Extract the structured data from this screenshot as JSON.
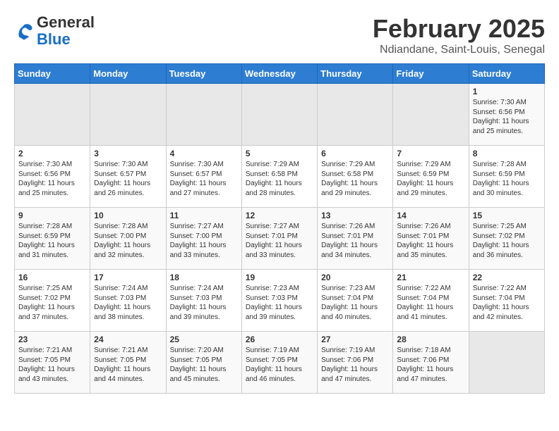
{
  "header": {
    "logo_general": "General",
    "logo_blue": "Blue",
    "title": "February 2025",
    "subtitle": "Ndiandane, Saint-Louis, Senegal"
  },
  "weekdays": [
    "Sunday",
    "Monday",
    "Tuesday",
    "Wednesday",
    "Thursday",
    "Friday",
    "Saturday"
  ],
  "weeks": [
    [
      {
        "day": "",
        "empty": true
      },
      {
        "day": "",
        "empty": true
      },
      {
        "day": "",
        "empty": true
      },
      {
        "day": "",
        "empty": true
      },
      {
        "day": "",
        "empty": true
      },
      {
        "day": "",
        "empty": true
      },
      {
        "day": "1",
        "sunrise": "7:30 AM",
        "sunset": "6:56 PM",
        "daylight": "11 hours and 25 minutes."
      }
    ],
    [
      {
        "day": "2",
        "sunrise": "7:30 AM",
        "sunset": "6:56 PM",
        "daylight": "11 hours and 25 minutes."
      },
      {
        "day": "3",
        "sunrise": "7:30 AM",
        "sunset": "6:57 PM",
        "daylight": "11 hours and 26 minutes."
      },
      {
        "day": "4",
        "sunrise": "7:30 AM",
        "sunset": "6:57 PM",
        "daylight": "11 hours and 27 minutes."
      },
      {
        "day": "5",
        "sunrise": "7:29 AM",
        "sunset": "6:58 PM",
        "daylight": "11 hours and 28 minutes."
      },
      {
        "day": "6",
        "sunrise": "7:29 AM",
        "sunset": "6:58 PM",
        "daylight": "11 hours and 29 minutes."
      },
      {
        "day": "7",
        "sunrise": "7:29 AM",
        "sunset": "6:59 PM",
        "daylight": "11 hours and 29 minutes."
      },
      {
        "day": "8",
        "sunrise": "7:28 AM",
        "sunset": "6:59 PM",
        "daylight": "11 hours and 30 minutes."
      }
    ],
    [
      {
        "day": "9",
        "sunrise": "7:28 AM",
        "sunset": "6:59 PM",
        "daylight": "11 hours and 31 minutes."
      },
      {
        "day": "10",
        "sunrise": "7:28 AM",
        "sunset": "7:00 PM",
        "daylight": "11 hours and 32 minutes."
      },
      {
        "day": "11",
        "sunrise": "7:27 AM",
        "sunset": "7:00 PM",
        "daylight": "11 hours and 33 minutes."
      },
      {
        "day": "12",
        "sunrise": "7:27 AM",
        "sunset": "7:01 PM",
        "daylight": "11 hours and 33 minutes."
      },
      {
        "day": "13",
        "sunrise": "7:26 AM",
        "sunset": "7:01 PM",
        "daylight": "11 hours and 34 minutes."
      },
      {
        "day": "14",
        "sunrise": "7:26 AM",
        "sunset": "7:01 PM",
        "daylight": "11 hours and 35 minutes."
      },
      {
        "day": "15",
        "sunrise": "7:25 AM",
        "sunset": "7:02 PM",
        "daylight": "11 hours and 36 minutes."
      }
    ],
    [
      {
        "day": "16",
        "sunrise": "7:25 AM",
        "sunset": "7:02 PM",
        "daylight": "11 hours and 37 minutes."
      },
      {
        "day": "17",
        "sunrise": "7:24 AM",
        "sunset": "7:03 PM",
        "daylight": "11 hours and 38 minutes."
      },
      {
        "day": "18",
        "sunrise": "7:24 AM",
        "sunset": "7:03 PM",
        "daylight": "11 hours and 39 minutes."
      },
      {
        "day": "19",
        "sunrise": "7:23 AM",
        "sunset": "7:03 PM",
        "daylight": "11 hours and 39 minutes."
      },
      {
        "day": "20",
        "sunrise": "7:23 AM",
        "sunset": "7:04 PM",
        "daylight": "11 hours and 40 minutes."
      },
      {
        "day": "21",
        "sunrise": "7:22 AM",
        "sunset": "7:04 PM",
        "daylight": "11 hours and 41 minutes."
      },
      {
        "day": "22",
        "sunrise": "7:22 AM",
        "sunset": "7:04 PM",
        "daylight": "11 hours and 42 minutes."
      }
    ],
    [
      {
        "day": "23",
        "sunrise": "7:21 AM",
        "sunset": "7:05 PM",
        "daylight": "11 hours and 43 minutes."
      },
      {
        "day": "24",
        "sunrise": "7:21 AM",
        "sunset": "7:05 PM",
        "daylight": "11 hours and 44 minutes."
      },
      {
        "day": "25",
        "sunrise": "7:20 AM",
        "sunset": "7:05 PM",
        "daylight": "11 hours and 45 minutes."
      },
      {
        "day": "26",
        "sunrise": "7:19 AM",
        "sunset": "7:05 PM",
        "daylight": "11 hours and 46 minutes."
      },
      {
        "day": "27",
        "sunrise": "7:19 AM",
        "sunset": "7:06 PM",
        "daylight": "11 hours and 47 minutes."
      },
      {
        "day": "28",
        "sunrise": "7:18 AM",
        "sunset": "7:06 PM",
        "daylight": "11 hours and 47 minutes."
      },
      {
        "day": "",
        "empty": true
      }
    ]
  ]
}
